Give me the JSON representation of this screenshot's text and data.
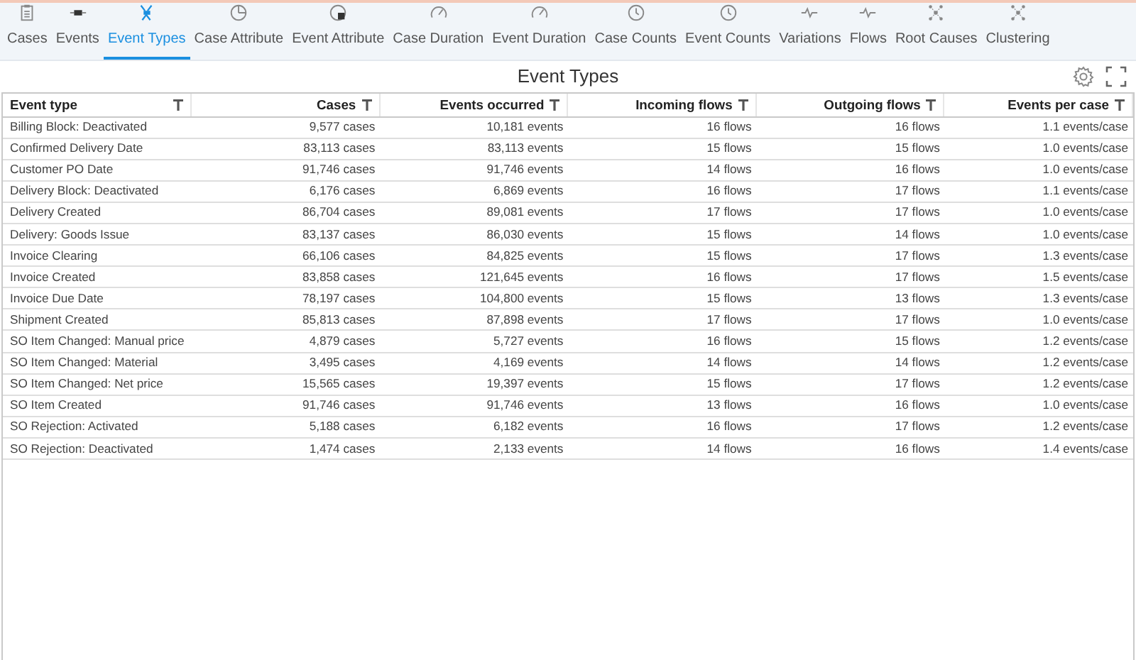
{
  "tabs": [
    {
      "label": "Cases",
      "selected": false
    },
    {
      "label": "Events",
      "selected": false
    },
    {
      "label": "Event Types",
      "selected": true
    },
    {
      "label": "Case Attribute",
      "selected": false
    },
    {
      "label": "Event Attribute",
      "selected": false
    },
    {
      "label": "Case Duration",
      "selected": false
    },
    {
      "label": "Event Duration",
      "selected": false
    },
    {
      "label": "Case Counts",
      "selected": false
    },
    {
      "label": "Event Counts",
      "selected": false
    },
    {
      "label": "Variations",
      "selected": false
    },
    {
      "label": "Flows",
      "selected": false
    },
    {
      "label": "Root Causes",
      "selected": false
    },
    {
      "label": "Clustering",
      "selected": false
    }
  ],
  "title": "Event Types",
  "table": {
    "columns": [
      "Event type",
      "Cases",
      "Events occurred",
      "Incoming flows",
      "Outgoing flows",
      "Events per case"
    ],
    "rows": [
      [
        "Billing Block: Deactivated",
        "9,577 cases",
        "10,181 events",
        "16 flows",
        "16 flows",
        "1.1 events/case"
      ],
      [
        "Confirmed Delivery Date",
        "83,113 cases",
        "83,113 events",
        "15 flows",
        "15 flows",
        "1.0 events/case"
      ],
      [
        "Customer PO Date",
        "91,746 cases",
        "91,746 events",
        "14 flows",
        "16 flows",
        "1.0 events/case"
      ],
      [
        "Delivery Block: Deactivated",
        "6,176 cases",
        "6,869 events",
        "16 flows",
        "17 flows",
        "1.1 events/case"
      ],
      [
        "Delivery Created",
        "86,704 cases",
        "89,081 events",
        "17 flows",
        "17 flows",
        "1.0 events/case"
      ],
      [
        "Delivery: Goods Issue",
        "83,137 cases",
        "86,030 events",
        "15 flows",
        "14 flows",
        "1.0 events/case"
      ],
      [
        "Invoice Clearing",
        "66,106 cases",
        "84,825 events",
        "15 flows",
        "17 flows",
        "1.3 events/case"
      ],
      [
        "Invoice Created",
        "83,858 cases",
        "121,645 events",
        "16 flows",
        "17 flows",
        "1.5 events/case"
      ],
      [
        "Invoice Due Date",
        "78,197 cases",
        "104,800 events",
        "15 flows",
        "13 flows",
        "1.3 events/case"
      ],
      [
        "Shipment Created",
        "85,813 cases",
        "87,898 events",
        "17 flows",
        "17 flows",
        "1.0 events/case"
      ],
      [
        "SO Item Changed: Manual price",
        "4,879 cases",
        "5,727 events",
        "16 flows",
        "15 flows",
        "1.2 events/case"
      ],
      [
        "SO Item Changed: Material",
        "3,495 cases",
        "4,169 events",
        "14 flows",
        "14 flows",
        "1.2 events/case"
      ],
      [
        "SO Item Changed: Net price",
        "15,565 cases",
        "19,397 events",
        "15 flows",
        "17 flows",
        "1.2 events/case"
      ],
      [
        "SO Item Created",
        "91,746 cases",
        "91,746 events",
        "13 flows",
        "16 flows",
        "1.0 events/case"
      ],
      [
        "SO Rejection: Activated",
        "5,188 cases",
        "6,182 events",
        "16 flows",
        "17 flows",
        "1.2 events/case"
      ],
      [
        "SO Rejection: Deactivated",
        "1,474 cases",
        "2,133 events",
        "14 flows",
        "16 flows",
        "1.4 events/case"
      ]
    ]
  }
}
